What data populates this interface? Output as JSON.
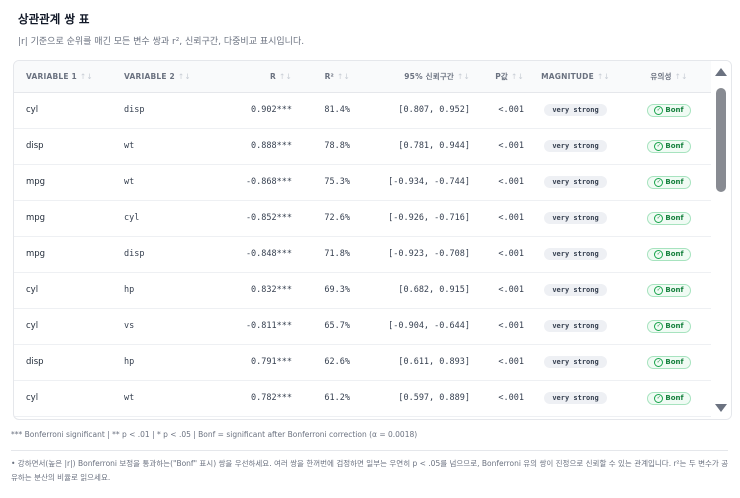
{
  "title": "상관관계 쌍 표",
  "subtitle": "|r| 기준으로 순위를 매긴 모든 변수 쌍과 r², 신뢰구간, 다중비교 표시입니다.",
  "columns": [
    "VARIABLE 1",
    "VARIABLE 2",
    "R",
    "R²",
    "95% 신뢰구간",
    "P값",
    "MAGNITUDE",
    "유의성"
  ],
  "sort_icon": "↑↓",
  "rows": [
    {
      "v1": "cyl",
      "v2": "disp",
      "r": "0.902***",
      "r2": "81.4%",
      "ci": "[0.807, 0.952]",
      "p": "<.001",
      "magnitude": "very strong",
      "sig": "Bonf"
    },
    {
      "v1": "disp",
      "v2": "wt",
      "r": "0.888***",
      "r2": "78.8%",
      "ci": "[0.781, 0.944]",
      "p": "<.001",
      "magnitude": "very strong",
      "sig": "Bonf"
    },
    {
      "v1": "mpg",
      "v2": "wt",
      "r": "-0.868***",
      "r2": "75.3%",
      "ci": "[-0.934, -0.744]",
      "p": "<.001",
      "magnitude": "very strong",
      "sig": "Bonf"
    },
    {
      "v1": "mpg",
      "v2": "cyl",
      "r": "-0.852***",
      "r2": "72.6%",
      "ci": "[-0.926, -0.716]",
      "p": "<.001",
      "magnitude": "very strong",
      "sig": "Bonf"
    },
    {
      "v1": "mpg",
      "v2": "disp",
      "r": "-0.848***",
      "r2": "71.8%",
      "ci": "[-0.923, -0.708]",
      "p": "<.001",
      "magnitude": "very strong",
      "sig": "Bonf"
    },
    {
      "v1": "cyl",
      "v2": "hp",
      "r": "0.832***",
      "r2": "69.3%",
      "ci": "[0.682, 0.915]",
      "p": "<.001",
      "magnitude": "very strong",
      "sig": "Bonf"
    },
    {
      "v1": "cyl",
      "v2": "vs",
      "r": "-0.811***",
      "r2": "65.7%",
      "ci": "[-0.904, -0.644]",
      "p": "<.001",
      "magnitude": "very strong",
      "sig": "Bonf"
    },
    {
      "v1": "disp",
      "v2": "hp",
      "r": "0.791***",
      "r2": "62.6%",
      "ci": "[0.611, 0.893]",
      "p": "<.001",
      "magnitude": "very strong",
      "sig": "Bonf"
    },
    {
      "v1": "cyl",
      "v2": "wt",
      "r": "0.782***",
      "r2": "61.2%",
      "ci": "[0.597, 0.889]",
      "p": "<.001",
      "magnitude": "very strong",
      "sig": "Bonf"
    }
  ],
  "footnote": "*** Bonferroni significant | ** p < .01 | * p < .05 | Bonf = significant after Bonferroni correction (α = 0.0018)",
  "note": "• 강하면서(높은 |r|) Bonferroni 보정을 통과하는(\"Bonf\" 표시) 쌍을 우선하세요. 여러 쌍을 한꺼번에 검정하면 일부는 우연히 p < .05를 넘으므로, Bonferroni 유의 쌍이 진정으로 신뢰할 수 있는 관계입니다. r²는 두 변수가 공유하는 분산의 비율로 읽으세요.",
  "colors": {
    "bonf_green": "#15803d",
    "badge_bg": "#eef0f4",
    "header_bg": "#f9fafb"
  },
  "icons": {
    "sig_badge": "check-circle-icon",
    "scroll_up": "triangle-up-icon",
    "scroll_down": "triangle-down-icon"
  }
}
